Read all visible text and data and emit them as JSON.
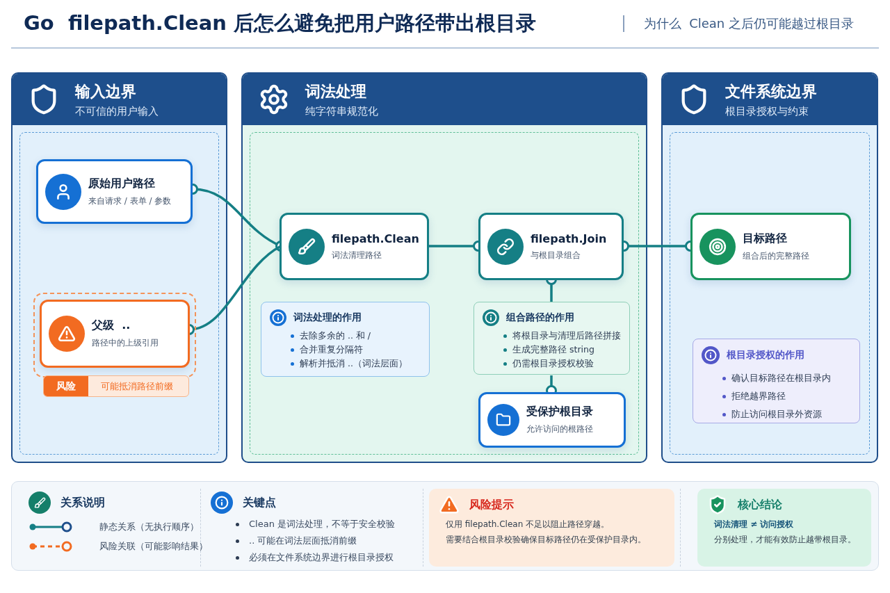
{
  "header": {
    "title": "Go  filepath.Clean 后怎么避免把用户路径带出根目录",
    "subtitle": "为什么  Clean 之后仍可能越过根目录"
  },
  "columns": [
    {
      "title": "输入边界",
      "subtitle": "不可信的用户输入",
      "color": "#e2f0fb"
    },
    {
      "title": "词法处理",
      "subtitle": "纯字符串规范化",
      "color": "#e3f6ef"
    },
    {
      "title": "文件系统边界",
      "subtitle": "根目录授权与约束",
      "color": "#e2f0fb"
    }
  ],
  "nodes": [
    {
      "title": "原始用户路径",
      "subtitle": "来自请求 / 表单 / 参数",
      "color": "#1570d4"
    },
    {
      "title": "父级  ..",
      "subtitle": "路径中的上级引用",
      "color": "#f26b21",
      "risk": {
        "label": "风险",
        "text": "可能抵消路径前缀"
      }
    },
    {
      "title": "filepath.Clean",
      "subtitle": "词法清理路径",
      "color": "#157f85"
    },
    {
      "title": "filepath.Join",
      "subtitle": "与根目录组合",
      "color": "#157f85"
    },
    {
      "title": "目标路径",
      "subtitle": "组合后的完整路径",
      "color": "#18935e"
    },
    {
      "title": "受保护根目录",
      "subtitle": "允许访问的根路径",
      "color": "#1570d4"
    }
  ],
  "notes": [
    {
      "title": "词法处理的作用",
      "color": "#1570d4",
      "items": [
        "去除多余的 .. 和 /",
        "合并重复分隔符",
        "解析并抵消 ..（词法层面）"
      ]
    },
    {
      "title": "组合路径的作用",
      "color": "#157f85",
      "items": [
        "将根目录与清理后路径拼接",
        "生成完整路径  string",
        "仍需根目录授权校验"
      ]
    },
    {
      "title": "根目录授权的作用",
      "color": "#5257c8",
      "items": [
        "确认目标路径在根目录内",
        "拒绝越界路径",
        "防止访问根目录外资源"
      ]
    }
  ],
  "footer": {
    "legend": {
      "title": "关系说明",
      "items": [
        {
          "kind": "static",
          "label": "静态关系（无执行顺序）"
        },
        {
          "kind": "risk",
          "label": "风险关联（可能影响结果）"
        }
      ]
    },
    "keypoints": {
      "title": "关键点",
      "items": [
        "Clean 是词法处理，不等于安全校验",
        ".. 可能在词法层面抵消前缀",
        "必须在文件系统边界进行根目录授权"
      ]
    },
    "risk": {
      "title": "风险提示",
      "lines": [
        "仅用 filepath.Clean 不足以阻止路径穿越。",
        "需要结合根目录校验确保目标路径仍在受保护目录内。"
      ]
    },
    "conclusion": {
      "title": "核心结论",
      "emphasis": "词法清理 ≠ 访问授权",
      "text": "分别处理，才能有效防止越带根目录。"
    }
  }
}
